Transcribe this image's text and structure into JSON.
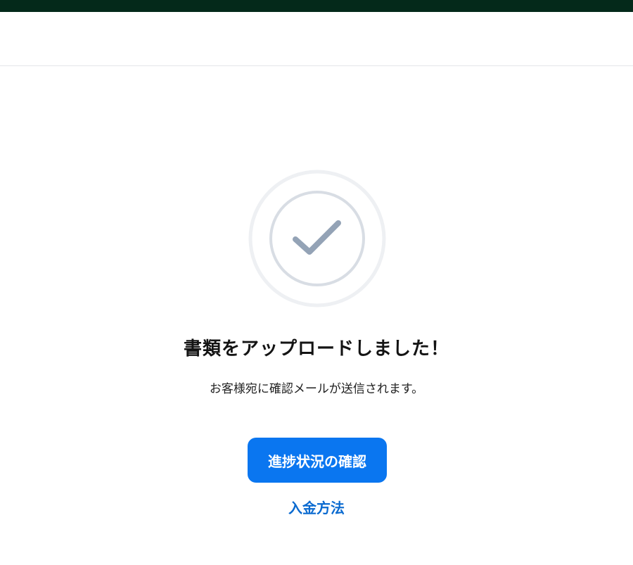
{
  "colors": {
    "top_bar": "#04291a",
    "accent": "#0a76f0",
    "link": "#0a6ad0",
    "check": "#94a3b6",
    "ring_outer": "#eef0f3",
    "ring_inner": "#d8dde4"
  },
  "main": {
    "icon": "check-circle-icon",
    "title": "書類をアップロードしました！",
    "subtitle": "お客様宛に確認メールが送信されます。",
    "primary_button_label": "進捗状況の確認",
    "link_label": "入金方法"
  }
}
